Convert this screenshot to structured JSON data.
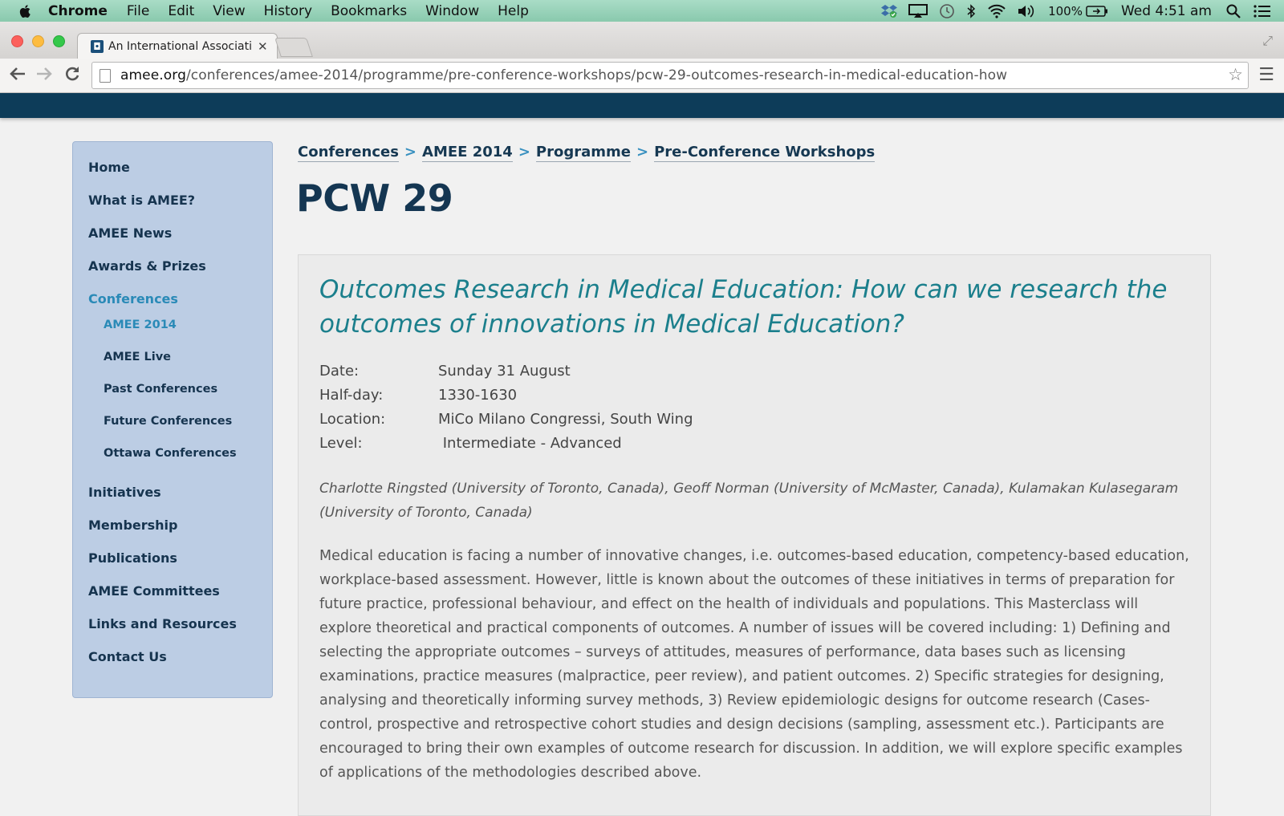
{
  "menubar": {
    "app": "Chrome",
    "items": [
      "File",
      "Edit",
      "View",
      "History",
      "Bookmarks",
      "Window",
      "Help"
    ],
    "battery": "100%",
    "clock": "Wed 4:51 am"
  },
  "browser": {
    "tab_title": "An International Associatio",
    "url_host": "amee.org",
    "url_path": "/conferences/amee-2014/programme/pre-conference-workshops/pcw-29-outcomes-research-in-medical-education-how"
  },
  "sidebar": {
    "items": [
      "Home",
      "What is AMEE?",
      "AMEE News",
      "Awards & Prizes",
      "Conferences"
    ],
    "subitems": [
      "AMEE 2014",
      "AMEE Live",
      "Past Conferences",
      "Future Conferences",
      "Ottawa Conferences"
    ],
    "items_after": [
      "Initiatives",
      "Membership",
      "Publications",
      "AMEE Committees",
      "Links and Resources",
      "Contact Us"
    ]
  },
  "breadcrumb": {
    "crumbs": [
      "Conferences",
      "AMEE 2014",
      "Programme",
      "Pre-Conference Workshops"
    ],
    "separator": ">"
  },
  "page": {
    "title": "PCW 29",
    "workshop_title": "Outcomes Research in Medical Education: How can we research the outcomes of innovations in Medical Education?",
    "meta": [
      {
        "label": "Date:",
        "value": "Sunday 31 August"
      },
      {
        "label": "Half-day:",
        "value": "1330-1630"
      },
      {
        "label": "Location:",
        "value": "MiCo Milano Congressi, South Wing"
      },
      {
        "label": "Level:",
        "value": " Intermediate - Advanced"
      }
    ],
    "authors": "Charlotte Ringsted (University of Toronto, Canada), Geoff Norman (University of McMaster, Canada), Kulamakan Kulasegaram (University of Toronto, Canada)",
    "description": "Medical education is facing a number of innovative changes, i.e. outcomes-based education, competency-based education, workplace-based assessment. However, little is known about the outcomes of these initiatives in terms of preparation for future practice, professional behaviour, and effect on the health of individuals and populations. This Masterclass will explore theoretical and practical components of outcomes. A number of issues will be covered including: 1) Defining and selecting the appropriate outcomes – surveys of attitudes, measures of performance, data bases such as licensing examinations, practice measures (malpractice, peer review), and patient outcomes. 2) Specific strategies for designing, analysing and theoretically informing survey methods, 3) Review epidemiologic designs for outcome research (Cases-control, prospective and retrospective cohort studies and design decisions (sampling, assessment etc.). Participants are encouraged to bring their own examples of outcome research for discussion. In addition, we will explore specific examples of applications of the methodologies described above."
  },
  "colors": {
    "header": "#0d3c59",
    "sidebar_bg": "#bccde4",
    "link_dark": "#16344f",
    "link_active": "#2a8ab7",
    "workshop_title": "#1b7f8c"
  }
}
